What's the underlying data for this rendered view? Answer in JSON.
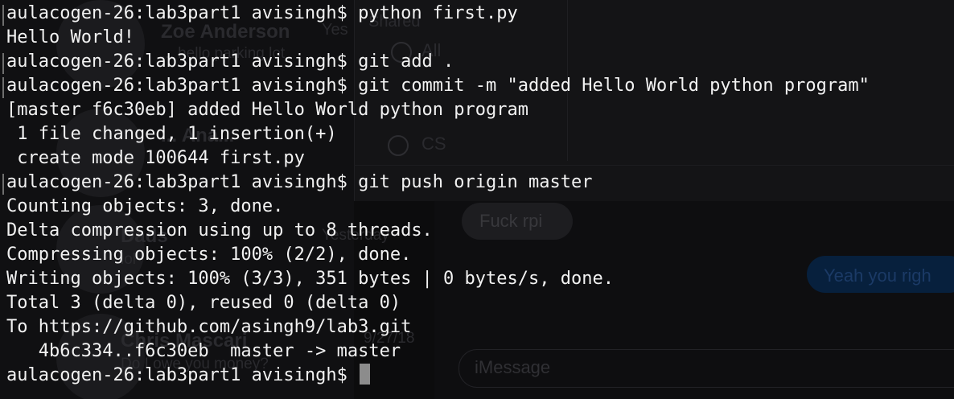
{
  "background_window": {
    "contacts": [
      {
        "name": "Zoe Anderson",
        "preview": "... hello parking lot"
      },
      {
        "name": "... Ana...",
        "preview": "..."
      },
      {
        "name": "Dads",
        "preview": "lol"
      },
      {
        "name": "Chris Mascari",
        "preview": "Do I owe you money?"
      }
    ],
    "poll": {
      "label": "Shared",
      "options": [
        "All",
        "CS"
      ],
      "yes_label": "Yes"
    },
    "timestamps": [
      "Yesterday",
      "9/27/18"
    ],
    "messages": {
      "incoming": "Fuck rpi",
      "outgoing": "Yeah you righ"
    },
    "input_placeholder": "iMessage"
  },
  "terminal": {
    "prompt": "aulacogen-26:lab3part1 avisingh$ ",
    "lines": [
      {
        "text": "aulacogen-26:lab3part1 avisingh$ python first.py"
      },
      {
        "text": "Hello World!"
      },
      {
        "text": "aulacogen-26:lab3part1 avisingh$ git add ."
      },
      {
        "text": "aulacogen-26:lab3part1 avisingh$ git commit -m \"added Hello World python program\""
      },
      {
        "text": "[master f6c30eb] added Hello World python program"
      },
      {
        "text": " 1 file changed, 1 insertion(+)"
      },
      {
        "text": " create mode 100644 first.py"
      },
      {
        "text": "aulacogen-26:lab3part1 avisingh$ git push origin master"
      },
      {
        "text": "Counting objects: 3, done."
      },
      {
        "text": "Delta compression using up to 8 threads."
      },
      {
        "text": "Compressing objects: 100% (2/2), done."
      },
      {
        "text": "Writing objects: 100% (3/3), 351 bytes | 0 bytes/s, done."
      },
      {
        "text": "Total 3 (delta 0), reused 0 (delta 0)"
      },
      {
        "text": "To https://github.com/asingh9/lab3.git"
      },
      {
        "text": "   4b6c334..f6c30eb  master -> master"
      }
    ],
    "cursor_icon": "block-cursor"
  }
}
